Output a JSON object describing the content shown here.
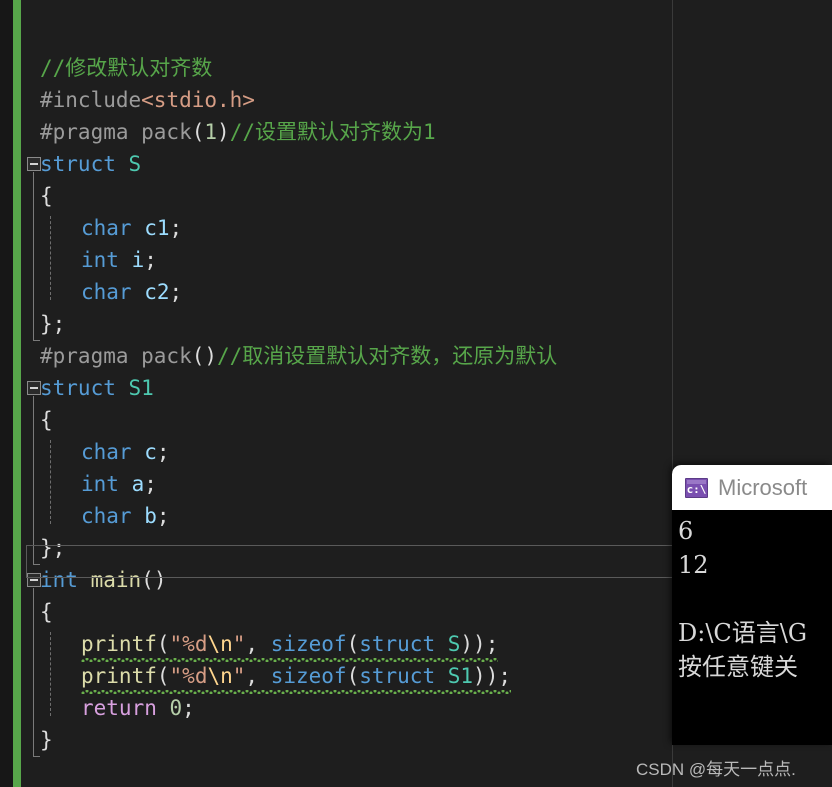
{
  "editor": {
    "background_color": "#1e1e1e",
    "change_bar_color": "#57a64a",
    "lines": [
      {
        "indent": 0,
        "fold": false,
        "tokens": [
          {
            "t": "//修改默认对齐数",
            "c": "comment"
          }
        ]
      },
      {
        "indent": 0,
        "fold": false,
        "tokens": [
          {
            "t": "#include",
            "c": "pre"
          },
          {
            "t": "<stdio.h>",
            "c": "str"
          }
        ]
      },
      {
        "indent": 0,
        "fold": false,
        "tokens": [
          {
            "t": "#pragma pack",
            "c": "pre"
          },
          {
            "t": "(",
            "c": "punct"
          },
          {
            "t": "1",
            "c": "num"
          },
          {
            "t": ")",
            "c": "punct"
          },
          {
            "t": "//设置默认对齐数为1",
            "c": "comment"
          }
        ]
      },
      {
        "indent": 0,
        "fold": true,
        "tokens": [
          {
            "t": "struct",
            "c": "key"
          },
          {
            "t": " ",
            "c": "plain"
          },
          {
            "t": "S",
            "c": "type"
          }
        ]
      },
      {
        "indent": 0,
        "fold": false,
        "tokens": [
          {
            "t": "{",
            "c": "punct"
          }
        ]
      },
      {
        "indent": 1,
        "fold": false,
        "tokens": [
          {
            "t": "char",
            "c": "key"
          },
          {
            "t": " c1",
            "c": "var"
          },
          {
            "t": ";",
            "c": "punct"
          }
        ]
      },
      {
        "indent": 1,
        "fold": false,
        "tokens": [
          {
            "t": "int",
            "c": "key"
          },
          {
            "t": " i",
            "c": "var"
          },
          {
            "t": ";",
            "c": "punct"
          }
        ]
      },
      {
        "indent": 1,
        "fold": false,
        "tokens": [
          {
            "t": "char",
            "c": "key"
          },
          {
            "t": " c2",
            "c": "var"
          },
          {
            "t": ";",
            "c": "punct"
          }
        ]
      },
      {
        "indent": 0,
        "fold": false,
        "tokens": [
          {
            "t": "};",
            "c": "punct"
          }
        ]
      },
      {
        "indent": 0,
        "fold": false,
        "tokens": [
          {
            "t": "#pragma pack",
            "c": "pre"
          },
          {
            "t": "()",
            "c": "punct"
          },
          {
            "t": "//取消设置默认对齐数，还原为默认",
            "c": "comment"
          }
        ]
      },
      {
        "indent": 0,
        "fold": true,
        "tokens": [
          {
            "t": "struct",
            "c": "key"
          },
          {
            "t": " ",
            "c": "plain"
          },
          {
            "t": "S1",
            "c": "type"
          }
        ]
      },
      {
        "indent": 0,
        "fold": false,
        "tokens": [
          {
            "t": "{",
            "c": "punct"
          }
        ]
      },
      {
        "indent": 1,
        "fold": false,
        "tokens": [
          {
            "t": "char",
            "c": "key"
          },
          {
            "t": " c",
            "c": "var"
          },
          {
            "t": ";",
            "c": "punct"
          }
        ]
      },
      {
        "indent": 1,
        "fold": false,
        "tokens": [
          {
            "t": "int",
            "c": "key"
          },
          {
            "t": " a",
            "c": "var"
          },
          {
            "t": ";",
            "c": "punct"
          }
        ]
      },
      {
        "indent": 1,
        "fold": false,
        "tokens": [
          {
            "t": "char",
            "c": "key"
          },
          {
            "t": " b",
            "c": "var"
          },
          {
            "t": ";",
            "c": "punct"
          }
        ]
      },
      {
        "indent": 0,
        "fold": false,
        "tokens": [
          {
            "t": "};",
            "c": "punct"
          }
        ]
      },
      {
        "indent": 0,
        "fold": true,
        "tokens": [
          {
            "t": "int",
            "c": "key"
          },
          {
            "t": " ",
            "c": "plain"
          },
          {
            "t": "main",
            "c": "fn"
          },
          {
            "t": "()",
            "c": "punct"
          }
        ]
      },
      {
        "indent": 0,
        "fold": false,
        "tokens": [
          {
            "t": "{",
            "c": "punct"
          }
        ]
      },
      {
        "indent": 1,
        "fold": false,
        "squiggle": true,
        "tokens": [
          {
            "t": "printf",
            "c": "fn"
          },
          {
            "t": "(",
            "c": "punct"
          },
          {
            "t": "\"",
            "c": "str"
          },
          {
            "t": "%d",
            "c": "str"
          },
          {
            "t": "\\n",
            "c": "esc"
          },
          {
            "t": "\"",
            "c": "str"
          },
          {
            "t": ", ",
            "c": "punct"
          },
          {
            "t": "sizeof",
            "c": "key"
          },
          {
            "t": "(",
            "c": "punct"
          },
          {
            "t": "struct",
            "c": "key"
          },
          {
            "t": " ",
            "c": "plain"
          },
          {
            "t": "S",
            "c": "type"
          },
          {
            "t": "))",
            "c": "punct"
          },
          {
            "t": ";",
            "c": "punct"
          }
        ]
      },
      {
        "indent": 1,
        "fold": false,
        "squiggle": true,
        "tokens": [
          {
            "t": "printf",
            "c": "fn"
          },
          {
            "t": "(",
            "c": "punct"
          },
          {
            "t": "\"",
            "c": "str"
          },
          {
            "t": "%d",
            "c": "str"
          },
          {
            "t": "\\n",
            "c": "esc"
          },
          {
            "t": "\"",
            "c": "str"
          },
          {
            "t": ", ",
            "c": "punct"
          },
          {
            "t": "sizeof",
            "c": "key"
          },
          {
            "t": "(",
            "c": "punct"
          },
          {
            "t": "struct",
            "c": "key"
          },
          {
            "t": " ",
            "c": "plain"
          },
          {
            "t": "S1",
            "c": "type"
          },
          {
            "t": "))",
            "c": "punct"
          },
          {
            "t": ";",
            "c": "punct"
          }
        ]
      },
      {
        "indent": 1,
        "fold": false,
        "tokens": [
          {
            "t": "return",
            "c": "ctrl"
          },
          {
            "t": " ",
            "c": "plain"
          },
          {
            "t": "0",
            "c": "num"
          },
          {
            "t": ";",
            "c": "punct"
          }
        ]
      },
      {
        "indent": 0,
        "fold": false,
        "tokens": [
          {
            "t": "}",
            "c": "punct"
          }
        ]
      }
    ],
    "current_line_index": 15
  },
  "console": {
    "title": "Microsoft",
    "icon": "command-prompt-icon",
    "icon_prompt": "c:\\",
    "output": [
      "6",
      "12",
      "",
      "D:\\C语言\\G",
      "按任意键关"
    ]
  },
  "watermark": {
    "text": "CSDN @每天一点点."
  }
}
